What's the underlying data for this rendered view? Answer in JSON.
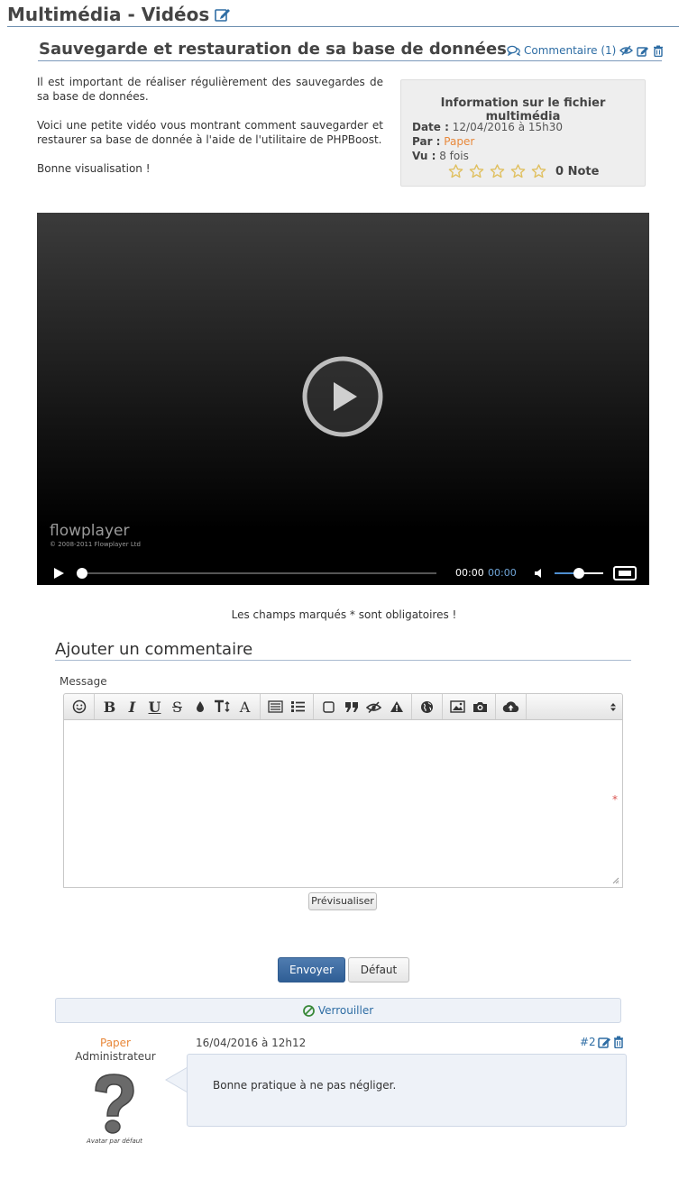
{
  "header": {
    "title": "Multimédia - Vidéos"
  },
  "article": {
    "title": "Sauvegarde et restauration de sa base de données",
    "comments_link": "Commentaire (1)",
    "intro_p1": "Il est important de réaliser régulièrement des sauvegardes de sa base de données.",
    "intro_p2": "Voici une petite vidéo vous montrant comment sauvegarder et restaurer sa base de donnée à l'aide de l'utilitaire de PHPBoost.",
    "intro_p3": "Bonne visualisation !"
  },
  "info_box": {
    "title": "Information sur le fichier multimédia",
    "date_label": "Date :",
    "date_value": "12/04/2016 à 15h30",
    "by_label": "Par :",
    "by_value": "Paper",
    "views_label": "Vu :",
    "views_value": "8 fois",
    "rating_stars": 5,
    "rating_value": 0,
    "rating_text": "0 Note"
  },
  "player": {
    "logo": "flowplayer",
    "copyright": "© 2008-2011 Flowplayer Ltd",
    "current_time": "00:00",
    "duration": "00:00",
    "progress": 0,
    "volume": 0.5
  },
  "form": {
    "required_note": "Les champs marqués * sont obligatoires !",
    "heading": "Ajouter un commentaire",
    "message_label": "Message",
    "required_marker": "*",
    "toolbar_icons": [
      "smiley-icon",
      "bold-icon",
      "italic-icon",
      "underline-icon",
      "strikethrough-icon",
      "color-icon",
      "size-icon",
      "font-icon",
      "paragraph-icon",
      "list-icon",
      "block-icon",
      "quote-icon",
      "hide-icon",
      "warning-icon",
      "globe-icon",
      "image-icon",
      "camera-icon",
      "upload-icon",
      "expand-icon"
    ],
    "toolbar_glyphs": {
      "bold": "B",
      "italic": "I",
      "underline": "U",
      "strike": "S",
      "font": "A"
    },
    "preview_label": "Prévisualiser",
    "send_label": "Envoyer",
    "reset_label": "Défaut"
  },
  "lock": {
    "label": "Verrouiller"
  },
  "comment": {
    "author": "Paper",
    "rank": "Administrateur",
    "avatar_caption": "Avatar par défaut",
    "date": "16/04/2016 à 12h12",
    "number": "#2",
    "text": "Bonne pratique à ne pas négliger."
  },
  "colors": {
    "link": "#2e6da4",
    "author": "#e8883a",
    "send_button": "#3b6aa0",
    "star": "#e0c060"
  }
}
